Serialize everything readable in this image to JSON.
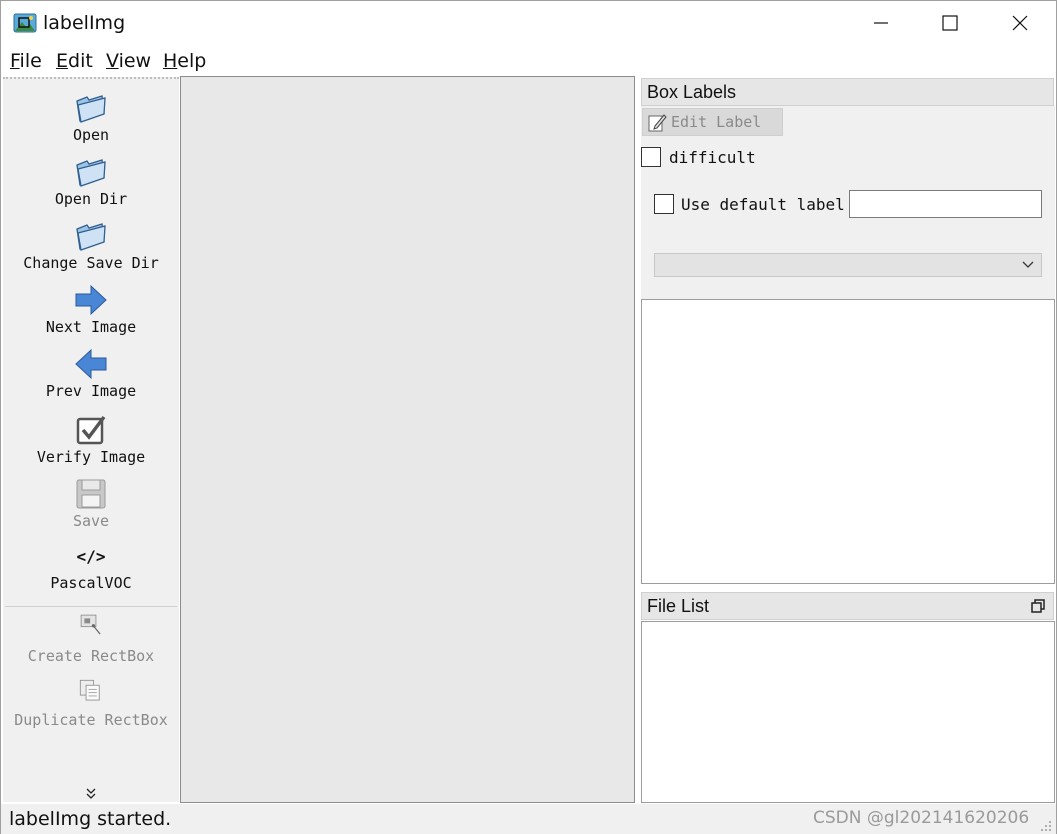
{
  "window": {
    "title": "labelImg"
  },
  "menu": [
    {
      "key": "F",
      "rest": "ile"
    },
    {
      "key": "E",
      "rest": "dit"
    },
    {
      "key": "V",
      "rest": "iew"
    },
    {
      "key": "H",
      "rest": "elp"
    }
  ],
  "toolbar": {
    "open": "Open",
    "open_dir": "Open Dir",
    "change_save_dir": "Change Save Dir",
    "next_image": "Next Image",
    "prev_image": "Prev Image",
    "verify_image": "Verify Image",
    "save": "Save",
    "format_glyph": "</>",
    "format": "PascalVOC",
    "create_rectbox": "Create RectBox",
    "duplicate_rectbox": "Duplicate RectBox",
    "more_glyph": "⌄⌄"
  },
  "box_labels": {
    "title": "Box Labels",
    "edit_label_button": "Edit Label",
    "difficult_label": "difficult",
    "use_default_label": "Use default label",
    "default_label_value": ""
  },
  "file_list": {
    "title": "File List"
  },
  "status": {
    "message": "labelImg started.",
    "watermark": "CSDN @gl202141620206"
  },
  "colors": {
    "canvas_bg": "#e8e8e8",
    "panel_bg": "#f0f0f0",
    "accent_blue": "#3f7bd1"
  }
}
